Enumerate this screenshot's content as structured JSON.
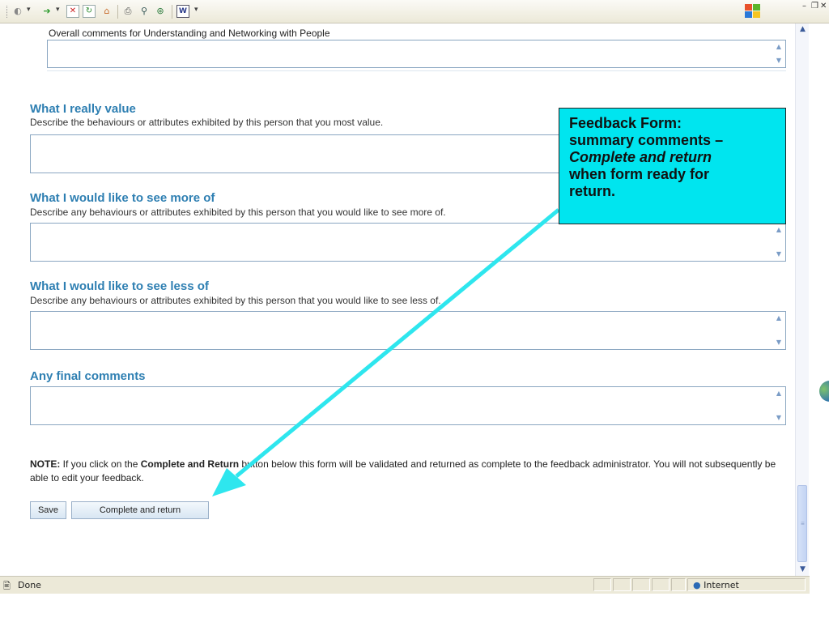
{
  "toolbar": {
    "icons": [
      "back-icon",
      "forward-icon",
      "stop-icon",
      "refresh-icon",
      "home-icon",
      "print-icon",
      "search-icon",
      "history-icon",
      "word-icon"
    ]
  },
  "content": {
    "top_prompt": "Overall comments for Understanding and Networking with People",
    "sections": [
      {
        "title": "What I really value",
        "desc": "Describe the behaviours or attributes exhibited by this person that you most value."
      },
      {
        "title": "What I would like to see more of",
        "desc": "Describe any behaviours or attributes exhibited by this person that you would like to see more of."
      },
      {
        "title": "What I would like to see less of",
        "desc": "Describe any behaviours or attributes exhibited by this person that you would like to see less of."
      },
      {
        "title": "Any final comments",
        "desc": ""
      }
    ],
    "note_label": "NOTE:",
    "note_pre": " If you click on the ",
    "note_bold": "Complete and Return",
    "note_post": " button below this form will be validated and returned as complete to the feedback administrator. You will not subsequently be able to edit your feedback.",
    "save_label": "Save",
    "complete_label": "Complete and return"
  },
  "callout": {
    "line1": "Feedback Form:",
    "line2": "summary comments –",
    "line3": "Complete and return",
    "line4": "when form ready for",
    "line5": "return.",
    "bg_color": "#00e5ef",
    "arrow_color": "#2ee6ee"
  },
  "status": {
    "text": "Done",
    "zone": "Internet"
  }
}
